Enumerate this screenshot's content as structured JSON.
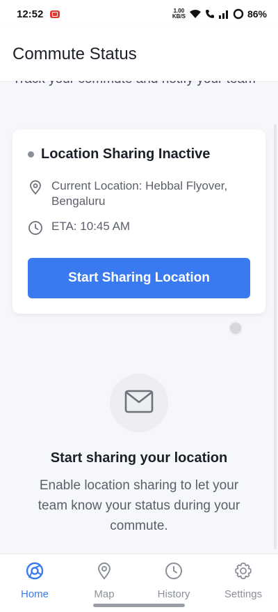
{
  "status_bar": {
    "time": "12:52",
    "net_speed_value": "1.00",
    "net_speed_unit": "KB/S",
    "battery": "86%"
  },
  "header": {
    "title": "Commute Status"
  },
  "subtitle": "Track your commute and notify your team",
  "card": {
    "status_title": "Location Sharing Inactive",
    "status_color": "#8a8f99",
    "current_location": "Current Location: Hebbal Flyover, Bengaluru",
    "eta": "ETA: 10:45 AM",
    "start_button_label": "Start Sharing Location",
    "button_color": "#3a7af0"
  },
  "empty_state": {
    "icon": "mail-icon",
    "title": "Start sharing your location",
    "description": "Enable location sharing to let your team know your status during your commute."
  },
  "bottom_nav": {
    "items": [
      {
        "label": "Home",
        "icon": "home-icon",
        "active": true
      },
      {
        "label": "Map",
        "icon": "map-pin-icon",
        "active": false
      },
      {
        "label": "History",
        "icon": "clock-icon",
        "active": false
      },
      {
        "label": "Settings",
        "icon": "gear-icon",
        "active": false
      }
    ]
  }
}
